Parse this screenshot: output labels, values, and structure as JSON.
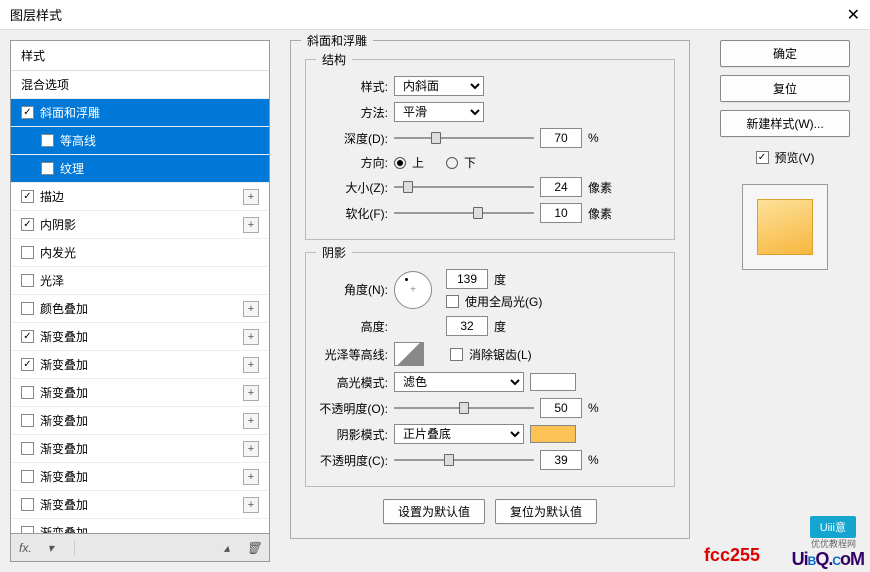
{
  "window": {
    "title": "图层样式",
    "close": "✕"
  },
  "left": {
    "header": "样式",
    "blend_options": "混合选项",
    "items": [
      {
        "id": "bevel",
        "label": "斜面和浮雕",
        "checked": true,
        "selected": true,
        "plus": false
      },
      {
        "id": "contour",
        "label": "等高线",
        "checked": false,
        "selected": true,
        "sub": true,
        "plus": false
      },
      {
        "id": "texture",
        "label": "纹理",
        "checked": false,
        "selected": true,
        "sub": true,
        "plus": false
      },
      {
        "id": "stroke",
        "label": "描边",
        "checked": true,
        "plus": true
      },
      {
        "id": "inner-shadow",
        "label": "内阴影",
        "checked": true,
        "plus": true
      },
      {
        "id": "inner-glow",
        "label": "内发光",
        "checked": false,
        "plus": false
      },
      {
        "id": "satin",
        "label": "光泽",
        "checked": false,
        "plus": false
      },
      {
        "id": "color-overlay",
        "label": "颜色叠加",
        "checked": false,
        "plus": true
      },
      {
        "id": "grad-overlay-1",
        "label": "渐变叠加",
        "checked": true,
        "plus": true
      },
      {
        "id": "grad-overlay-2",
        "label": "渐变叠加",
        "checked": true,
        "plus": true
      },
      {
        "id": "grad-overlay-3",
        "label": "渐变叠加",
        "checked": false,
        "plus": true
      },
      {
        "id": "grad-overlay-4",
        "label": "渐变叠加",
        "checked": false,
        "plus": true
      },
      {
        "id": "grad-overlay-5",
        "label": "渐变叠加",
        "checked": false,
        "plus": true
      },
      {
        "id": "grad-overlay-6",
        "label": "渐变叠加",
        "checked": false,
        "plus": true
      },
      {
        "id": "grad-overlay-7",
        "label": "渐变叠加",
        "checked": false,
        "plus": true
      },
      {
        "id": "grad-overlay-8",
        "label": "渐变叠加",
        "checked": false,
        "plus": false
      }
    ]
  },
  "panel": {
    "title": "斜面和浮雕",
    "structure": {
      "title": "结构",
      "style_lbl": "样式:",
      "style_val": "内斜面",
      "tech_lbl": "方法:",
      "tech_val": "平滑",
      "depth_lbl": "深度(D):",
      "depth_val": "70",
      "pct": "%",
      "dir_lbl": "方向:",
      "up": "上",
      "down": "下",
      "size_lbl": "大小(Z):",
      "size_val": "24",
      "px": "像素",
      "soften_lbl": "软化(F):",
      "soften_val": "10"
    },
    "shading": {
      "title": "阴影",
      "angle_lbl": "角度(N):",
      "angle_val": "139",
      "deg": "度",
      "global_lbl": "使用全局光(G)",
      "alt_lbl": "高度:",
      "alt_val": "32",
      "gloss_lbl": "光泽等高线:",
      "aa_lbl": "消除锯齿(L)",
      "hl_mode_lbl": "高光模式:",
      "hl_mode_val": "滤色",
      "opacity_lbl": "不透明度(O):",
      "hl_op_val": "50",
      "sh_mode_lbl": "阴影模式:",
      "sh_mode_val": "正片叠底",
      "opacity2_lbl": "不透明度(C):",
      "sh_op_val": "39"
    },
    "footer": {
      "default": "设置为默认值",
      "reset": "复位为默认值"
    }
  },
  "right": {
    "ok": "确定",
    "cancel": "复位",
    "new_style": "新建样式(W)...",
    "preview": "预览(V)"
  },
  "watermark": {
    "color": "fcc255",
    "badge": "Uiii意",
    "sub": "优优教程网",
    "uibq": "UiBQ.CoM"
  }
}
